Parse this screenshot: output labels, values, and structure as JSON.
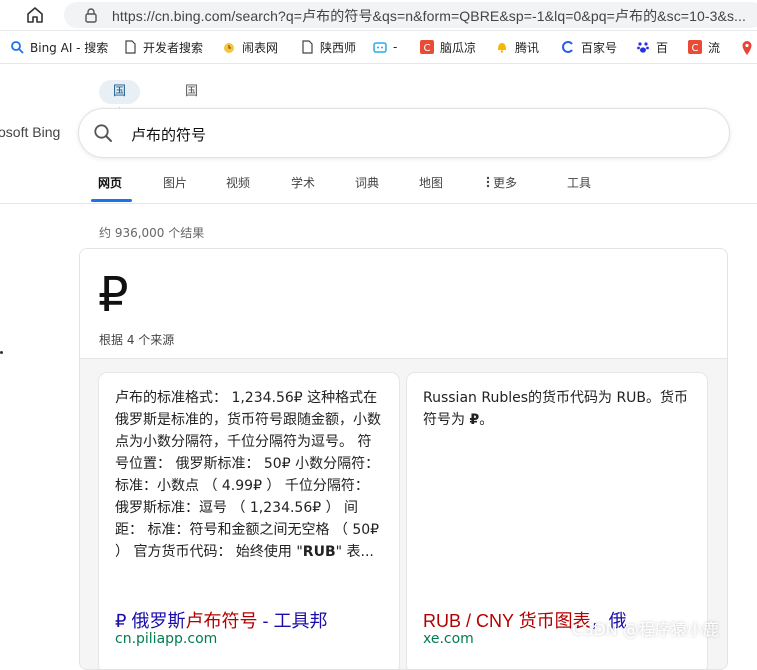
{
  "browser": {
    "url": "https://cn.bing.com/search?q=卢布的符号&qs=n&form=QBRE&sp=-1&lq=0&pq=卢布的&sc=10-3&s..."
  },
  "bookmarks": [
    {
      "label": "Bing AI - 搜索",
      "icon": "bing-search-icon"
    },
    {
      "label": "开发者搜索",
      "icon": "document-icon"
    },
    {
      "label": "闹表网",
      "icon": "clock-icon"
    },
    {
      "label": "陕西师",
      "icon": "document-icon"
    },
    {
      "label": "-",
      "icon": "bilibili-icon"
    },
    {
      "label": "脑瓜凉",
      "icon": "c-icon"
    },
    {
      "label": "腾讯",
      "icon": "bell-icon"
    },
    {
      "label": "百家号",
      "icon": "baijiahao-icon"
    },
    {
      "label": "百",
      "icon": "baidu-paw-icon"
    },
    {
      "label": "流",
      "icon": "c-icon"
    }
  ],
  "bing": {
    "brand": "osoft Bing",
    "region_tabs": [
      "国内版",
      "国际版"
    ],
    "query": "卢布的符号",
    "nav": [
      "网页",
      "图片",
      "视频",
      "学术",
      "词典",
      "地图",
      "更多",
      "工具"
    ],
    "result_count": "约 936,000 个结果"
  },
  "answer": {
    "symbol": "₽",
    "sources_label": "根据 4 个来源",
    "cards": [
      {
        "text_before_bold": "卢布的标准格式： 1,234.56₽ 这种格式在俄罗斯是标准的，货币符号跟随金额，小数点为小数分隔符，千位分隔符为逗号。 符号位置： 俄罗斯标准： 50₽ 小数分隔符： 标准：小数点 （ 4.99₽ ） 千位分隔符： 俄罗斯标准：逗号 （ 1,234.56₽ ） 间距： 标准：符号和金额之间无空格 （ 50₽ ） 官方货币代码： 始终使用 \"",
        "bold": "RUB",
        "text_after_bold": "\" 表...",
        "title_prefix": "₽ 俄罗斯",
        "title_highlight": "卢布符号",
        "title_suffix": " - 工具邦",
        "domain": "cn.piliapp.com"
      },
      {
        "text_before_bold": "Russian Rubles的货币代码为 RUB。货币符号为 ",
        "bold": "₽",
        "text_after_bold": "。",
        "title_prefix": "",
        "title_highlight": "RUB / CNY 货币图表",
        "title_suffix": "，俄",
        "domain": "xe.com"
      }
    ]
  },
  "watermark": "CSDN @程序猿小鹿"
}
